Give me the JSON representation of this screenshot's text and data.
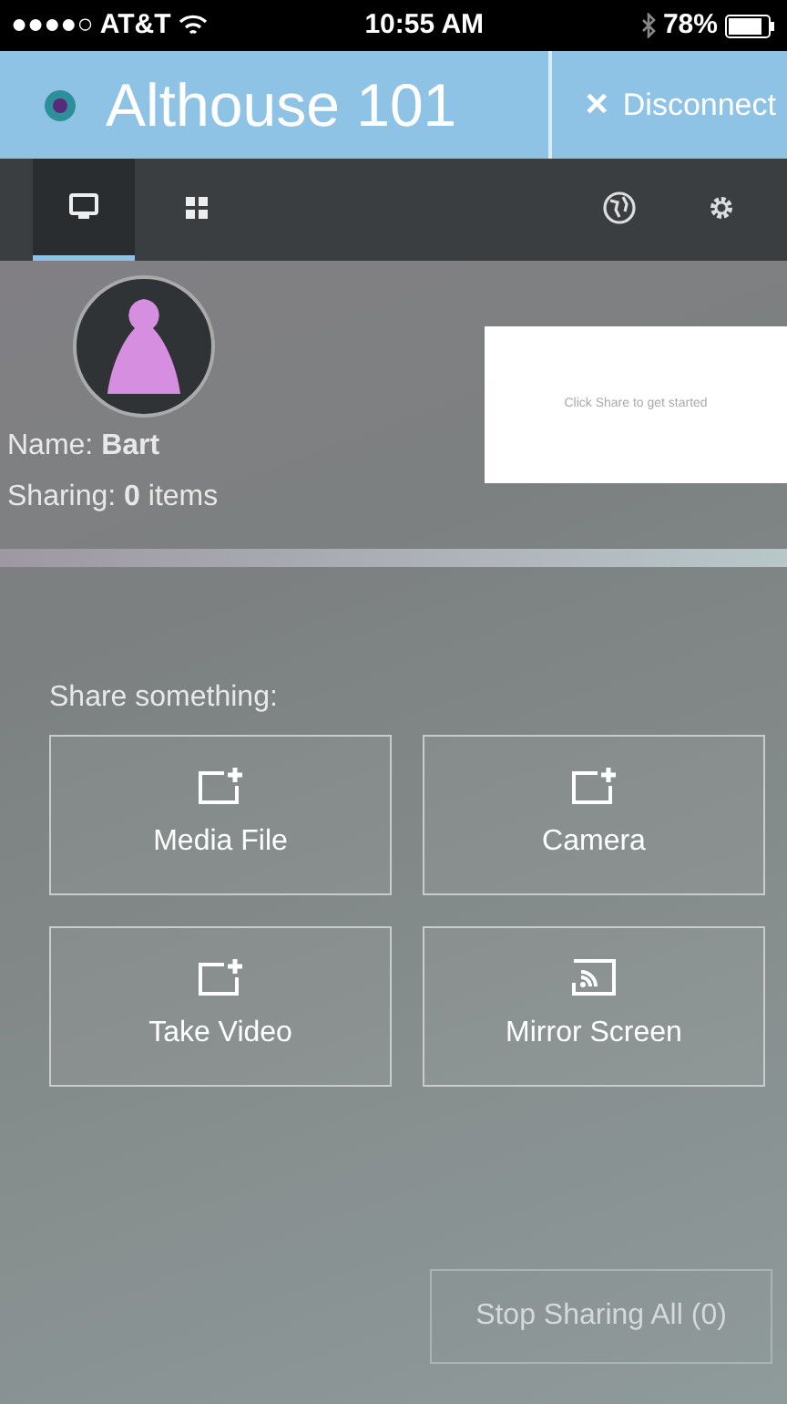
{
  "status_bar": {
    "carrier": "●●●●○ AT&T",
    "time": "10:55 AM",
    "battery": "78%"
  },
  "header": {
    "title": "Althouse 101",
    "disconnect": "Disconnect",
    "close_glyph": "×"
  },
  "tabs": [
    {
      "kind": "monitor",
      "selected": true
    },
    {
      "kind": "grid",
      "selected": false
    }
  ],
  "profile": {
    "name_label": "Name:",
    "name": "Bart",
    "sharing_label": "Sharing:",
    "sharing_count": "0",
    "sharing_unit": "items"
  },
  "preview": {
    "text": "Click Share to get started"
  },
  "share": {
    "heading": "Share something:",
    "items": [
      {
        "label": "Media File",
        "kind": "add"
      },
      {
        "label": "Camera",
        "kind": "add"
      },
      {
        "label": "Take Video",
        "kind": "add"
      },
      {
        "label": "Mirror Screen",
        "kind": "mirror"
      }
    ]
  },
  "stop_button": {
    "label": "Stop Sharing All (0)",
    "disabled": true
  }
}
